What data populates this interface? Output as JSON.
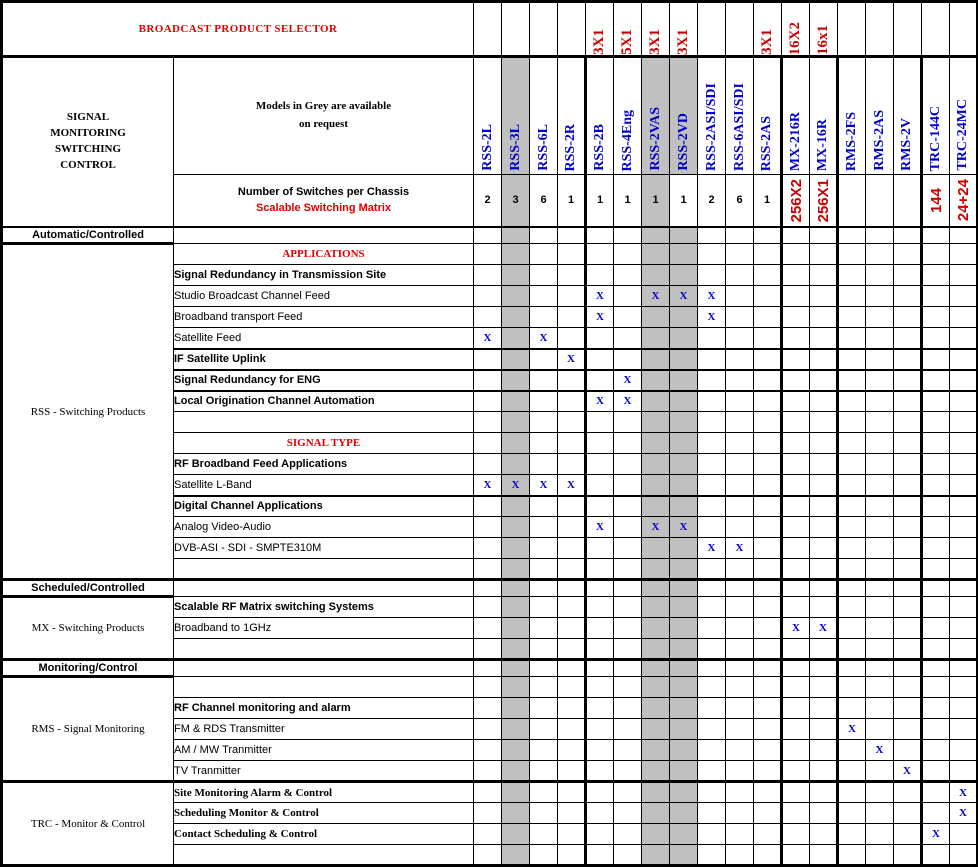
{
  "title": "BROADCAST PRODUCT SELECTOR",
  "left_panel": {
    "heading_lines": [
      "SIGNAL",
      "MONITORING",
      "SWITCHING",
      "CONTROL"
    ]
  },
  "models_note": {
    "line1": "Models in Grey are available",
    "line2": "on  request"
  },
  "switches_row": {
    "label_black": "Number of Switches per Chassis",
    "label_red": "Scalable Switching Matrix"
  },
  "colors": {
    "red": "#e00000",
    "dark_red": "#cc0000",
    "blue": "#0000cc",
    "grey": "#c0c0c0"
  },
  "columns": [
    {
      "index": 1,
      "top_label": "",
      "model": "RSS-2L",
      "switches": "2",
      "switches_red": false,
      "grey": false,
      "group_end": false
    },
    {
      "index": 2,
      "top_label": "",
      "model": "RSS-3L",
      "switches": "3",
      "switches_red": false,
      "grey": true,
      "group_end": false
    },
    {
      "index": 3,
      "top_label": "",
      "model": "RSS-6L",
      "switches": "6",
      "switches_red": false,
      "grey": false,
      "group_end": false
    },
    {
      "index": 4,
      "top_label": "",
      "model": "RSS-2R",
      "switches": "1",
      "switches_red": false,
      "grey": false,
      "group_end": true
    },
    {
      "index": 5,
      "top_label": "3X1",
      "model": "RSS-2B",
      "switches": "1",
      "switches_red": false,
      "grey": false,
      "group_end": false
    },
    {
      "index": 6,
      "top_label": "5X1",
      "model": "RSS-4Eng",
      "switches": "1",
      "switches_red": false,
      "grey": false,
      "group_end": false
    },
    {
      "index": 7,
      "top_label": "3X1",
      "model": "RSS-2VAS",
      "switches": "1",
      "switches_red": false,
      "grey": true,
      "group_end": false
    },
    {
      "index": 8,
      "top_label": "3X1",
      "model": "RSS-2VD",
      "switches": "1",
      "switches_red": false,
      "grey": true,
      "grey_num": false,
      "group_end": false
    },
    {
      "index": 9,
      "top_label": "",
      "model": "RSS-2ASI/SDI",
      "switches": "2",
      "switches_red": false,
      "grey": false,
      "group_end": false
    },
    {
      "index": 10,
      "top_label": "",
      "model": "RSS-6ASI/SDI",
      "switches": "6",
      "switches_red": false,
      "grey": false,
      "group_end": false
    },
    {
      "index": 11,
      "top_label": "3X1",
      "model": "RSS-2AS",
      "switches": "1",
      "switches_red": false,
      "grey": false,
      "group_end": true
    },
    {
      "index": 12,
      "top_label": "16X2",
      "model": "MX-216R",
      "switches": "256X2",
      "switches_red": true,
      "grey": false,
      "group_end": false
    },
    {
      "index": 13,
      "top_label": "16x1",
      "model": "MX-16R",
      "switches": "256X1",
      "switches_red": true,
      "grey": false,
      "group_end": true
    },
    {
      "index": 14,
      "top_label": "",
      "model": "RMS-2FS",
      "switches": "",
      "switches_red": false,
      "grey": false,
      "group_end": false
    },
    {
      "index": 15,
      "top_label": "",
      "model": "RMS-2AS",
      "switches": "",
      "switches_red": false,
      "grey": false,
      "group_end": false
    },
    {
      "index": 16,
      "top_label": "",
      "model": "RMS-2V",
      "switches": "",
      "switches_red": false,
      "grey": false,
      "group_end": true
    },
    {
      "index": 17,
      "top_label": "",
      "model": "TRC-144C",
      "switches": "144",
      "switches_red": true,
      "grey": false,
      "group_end": false
    },
    {
      "index": 18,
      "top_label": "",
      "model": "TRC-24MC",
      "switches": "24+24",
      "switches_red": true,
      "grey": false,
      "group_end": false
    }
  ],
  "sections": [
    {
      "bar": "Automatic/Controlled",
      "family": "RSS - Switching Products",
      "rows": [
        {
          "label": "APPLICATIONS",
          "style": "sect-red",
          "marks": []
        },
        {
          "label": "Signal Redundancy in Transmission Site",
          "style": "row-bold",
          "marks": []
        },
        {
          "label": "Studio Broadcast Channel Feed",
          "style": "row-sub",
          "marks": [
            5,
            7,
            8,
            9
          ]
        },
        {
          "label": "Broadband transport Feed",
          "style": "row-sub",
          "marks": [
            5,
            9
          ]
        },
        {
          "label": "Satellite Feed",
          "style": "row-sub",
          "marks": [
            1,
            3
          ]
        },
        {
          "label": "IF Satellite Uplink",
          "style": "row-bold",
          "marks": [
            4
          ],
          "sep_above": true
        },
        {
          "label": "Signal Redundancy for ENG",
          "style": "row-bold",
          "marks": [
            6
          ],
          "sep_above": true
        },
        {
          "label": "Local Origination Channel Automation",
          "style": "row-bold",
          "marks": [
            5,
            6
          ],
          "sep_above": true
        },
        {
          "label": "",
          "style": "row-blank",
          "marks": []
        },
        {
          "label": "SIGNAL TYPE",
          "style": "sect-red",
          "marks": []
        },
        {
          "label": "RF Broadband Feed Applications",
          "style": "row-bold",
          "marks": []
        },
        {
          "label": "Satellite L-Band",
          "style": "row-sub",
          "marks": [
            1,
            2,
            3,
            4
          ]
        },
        {
          "label": "Digital Channel Applications",
          "style": "row-bold",
          "marks": [],
          "sep_above": true
        },
        {
          "label": "Analog Video-Audio",
          "style": "row-sub",
          "marks": [
            5,
            7,
            8
          ]
        },
        {
          "label": "DVB-ASI - SDI - SMPTE310M",
          "style": "row-sub",
          "marks": [
            9,
            10
          ]
        },
        {
          "label": "",
          "style": "row-blank",
          "marks": []
        }
      ]
    },
    {
      "bar": "Scheduled/Controlled",
      "family": "MX - Switching Products",
      "rows": [
        {
          "label": "Scalable RF Matrix switching Systems",
          "style": "row-bold",
          "marks": []
        },
        {
          "label": "Broadband to 1GHz",
          "style": "row-sub",
          "marks": [
            12,
            13
          ]
        },
        {
          "label": "",
          "style": "row-blank",
          "marks": []
        }
      ]
    },
    {
      "bar": "Monitoring/Control",
      "family": "RMS - Signal Monitoring",
      "rows": [
        {
          "label": "",
          "style": "row-blank",
          "marks": []
        },
        {
          "label": "RF Channel monitoring and alarm",
          "style": "row-bold",
          "marks": []
        },
        {
          "label": "FM & RDS Transmitter",
          "style": "row-sub",
          "marks": [
            14
          ]
        },
        {
          "label": "AM / MW Tranmitter",
          "style": "row-sub",
          "marks": [
            15
          ]
        },
        {
          "label": "TV Tranmitter",
          "style": "row-sub",
          "marks": [
            16
          ]
        }
      ]
    },
    {
      "bar": "",
      "family": "TRC - Monitor & Control",
      "rows": [
        {
          "label": "Site Monitoring Alarm & Control",
          "style": "row-bold-serif",
          "marks": [
            18
          ]
        },
        {
          "label": "Scheduling Monitor & Control",
          "style": "row-bold-serif",
          "marks": [
            18
          ]
        },
        {
          "label": "Contact Scheduling & Control",
          "style": "row-bold-serif",
          "marks": [
            17
          ]
        },
        {
          "label": "",
          "style": "row-blank",
          "marks": []
        }
      ]
    }
  ],
  "mark_symbol": "X"
}
